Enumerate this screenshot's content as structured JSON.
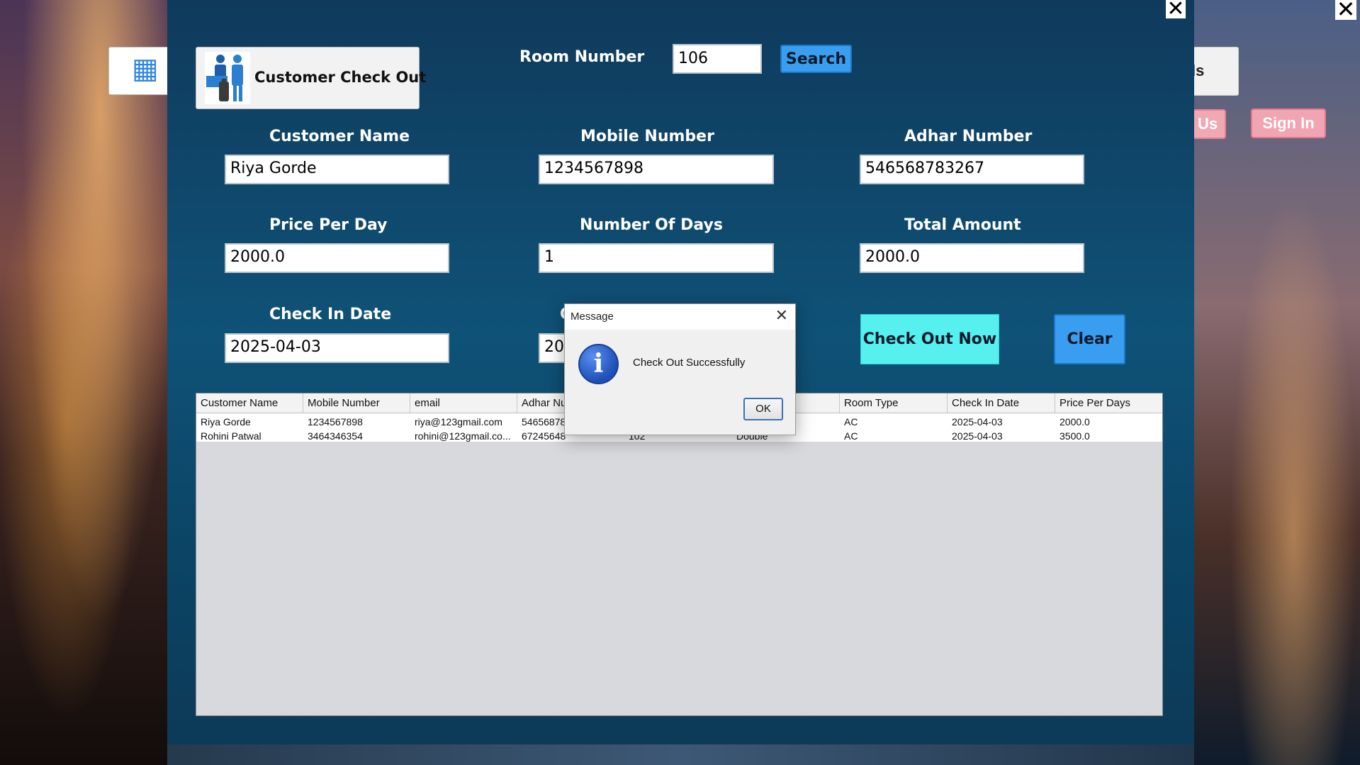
{
  "window": {
    "title_button_label": "Customer Check Out",
    "close_symbol": "✕"
  },
  "background_ui": {
    "right_button_partial": "ls",
    "right_button2_partial": "Us",
    "sign_in": "Sign In",
    "home_icon": "hotel-building-icon"
  },
  "search": {
    "room_label": "Room Number",
    "room_value": "106",
    "button_label": "Search"
  },
  "form": {
    "customer_name_label": "Customer Name",
    "customer_name_value": "Riya Gorde",
    "mobile_label": "Mobile Number",
    "mobile_value": "1234567898",
    "adhar_label": "Adhar Number",
    "adhar_value": "546568783267",
    "price_label": "Price Per Day",
    "price_value": "2000.0",
    "days_label": "Number Of Days",
    "days_value": "1",
    "total_label": "Total Amount",
    "total_value": "2000.0",
    "checkin_label": "Check In Date",
    "checkin_value": "2025-04-03",
    "checkout_label_partial": "C",
    "checkout_value_partial": "202"
  },
  "buttons": {
    "check_out_now": "Check Out Now",
    "clear": "Clear"
  },
  "table": {
    "columns": [
      "Customer Name",
      "Mobile Number",
      "email",
      "Adhar Nu",
      "",
      "",
      "Room Type",
      "Check In Date",
      "Price Per Days"
    ],
    "rows": [
      [
        "Riya Gorde",
        "1234567898",
        "riya@123gmail.com",
        "54656878",
        "",
        "",
        "AC",
        "2025-04-03",
        "2000.0"
      ],
      [
        "Rohini Patwal",
        "3464346354",
        "rohini@123gmail.co...",
        "67245648",
        "102",
        "Double",
        "AC",
        "2025-04-03",
        "3500.0"
      ]
    ]
  },
  "dialog": {
    "title": "Message",
    "close": "✕",
    "message": "Check Out Successfully",
    "ok": "OK",
    "icon": "information-icon"
  },
  "colors": {
    "panel": "#0f4a6e",
    "search_button": "#3a9ef0",
    "checkout_button": "#56f0ef",
    "sign_in_button": "#f1a4b1"
  }
}
